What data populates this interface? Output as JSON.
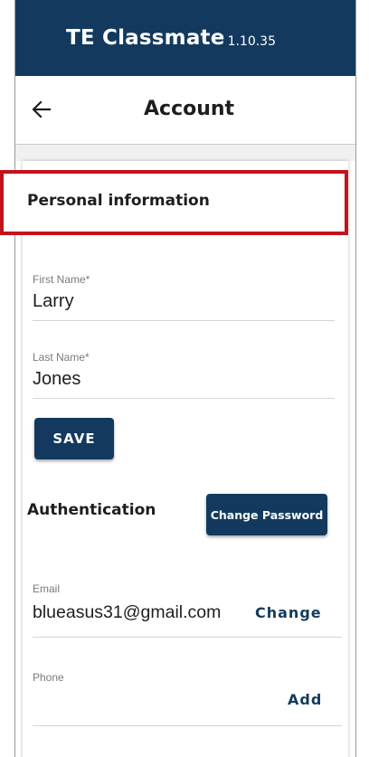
{
  "app": {
    "title": "TE Classmate",
    "version": "1.10.35"
  },
  "nav": {
    "title": "Account",
    "back_icon": "arrow-left-icon"
  },
  "personal_info": {
    "section_title": "Personal information",
    "first_name": {
      "label": "First Name*",
      "value": "Larry"
    },
    "last_name": {
      "label": "Last Name*",
      "value": "Jones"
    },
    "save_label": "SAVE"
  },
  "authentication": {
    "section_title": "Authentication",
    "change_password_label": "Change Password",
    "email": {
      "label": "Email",
      "value": "blueasus31@gmail.com",
      "action_label": "Change"
    },
    "phone": {
      "label": "Phone",
      "value": "",
      "action_label": "Add"
    }
  },
  "colors": {
    "brand": "#133a5e",
    "highlight": "#c4121c"
  }
}
